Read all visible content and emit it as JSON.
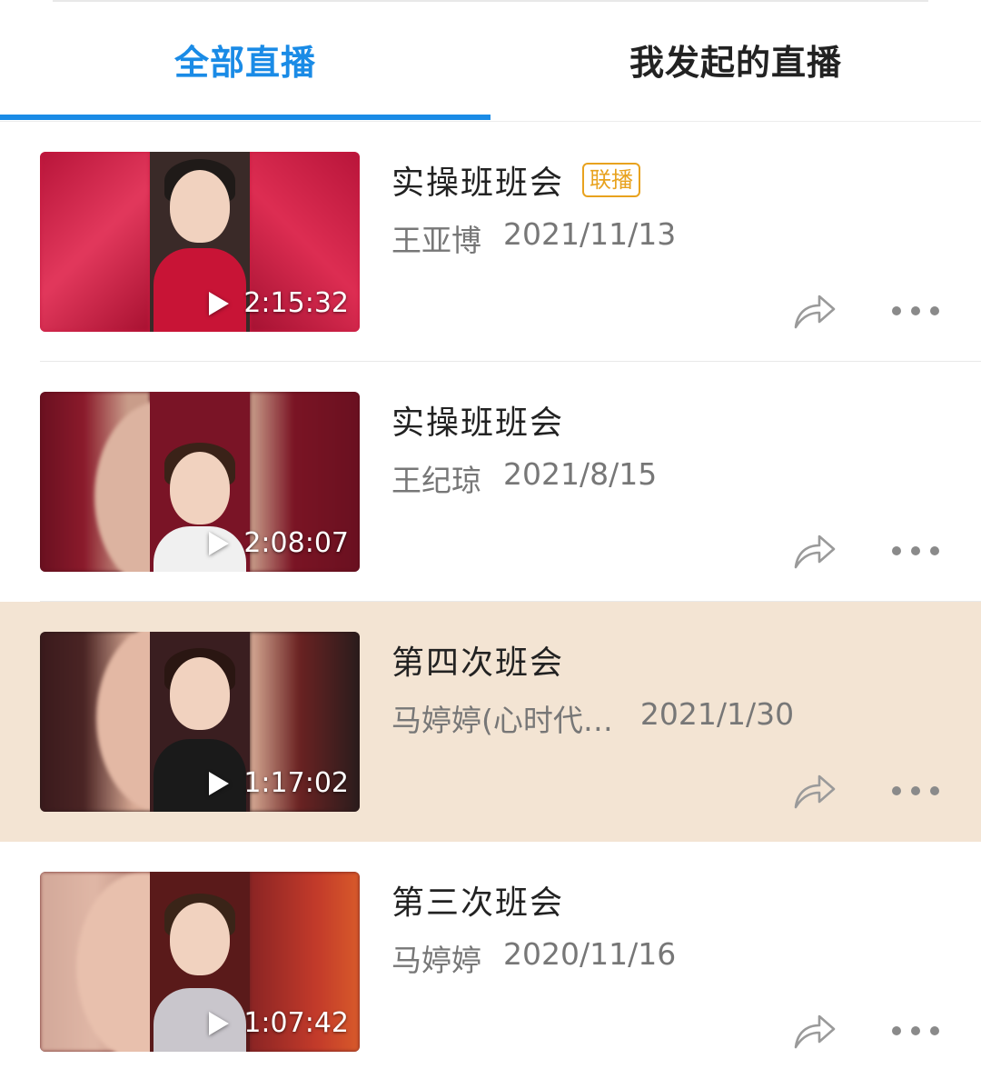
{
  "tabs": [
    {
      "label": "全部直播",
      "active": true
    },
    {
      "label": "我发起的直播",
      "active": false
    }
  ],
  "colors": {
    "accent": "#1a8be6",
    "highlight_row": "#f3e4d3",
    "badge": "#e8a21e"
  },
  "items": [
    {
      "title": "实操班班会",
      "badge": "联播",
      "author": "王亚博",
      "date": "2021/11/13",
      "duration": "2:15:32",
      "highlighted": false
    },
    {
      "title": "实操班班会",
      "badge": "",
      "author": "王纪琼",
      "date": "2021/8/15",
      "duration": "2:08:07",
      "highlighted": false
    },
    {
      "title": "第四次班会",
      "badge": "",
      "author": "马婷婷(心时代…",
      "date": "2021/1/30",
      "duration": "1:17:02",
      "highlighted": true
    },
    {
      "title": "第三次班会",
      "badge": "",
      "author": "马婷婷",
      "date": "2020/11/16",
      "duration": "1:07:42",
      "highlighted": false
    }
  ],
  "icons": {
    "play": "play-icon",
    "share": "share-icon",
    "more": "more-icon"
  }
}
